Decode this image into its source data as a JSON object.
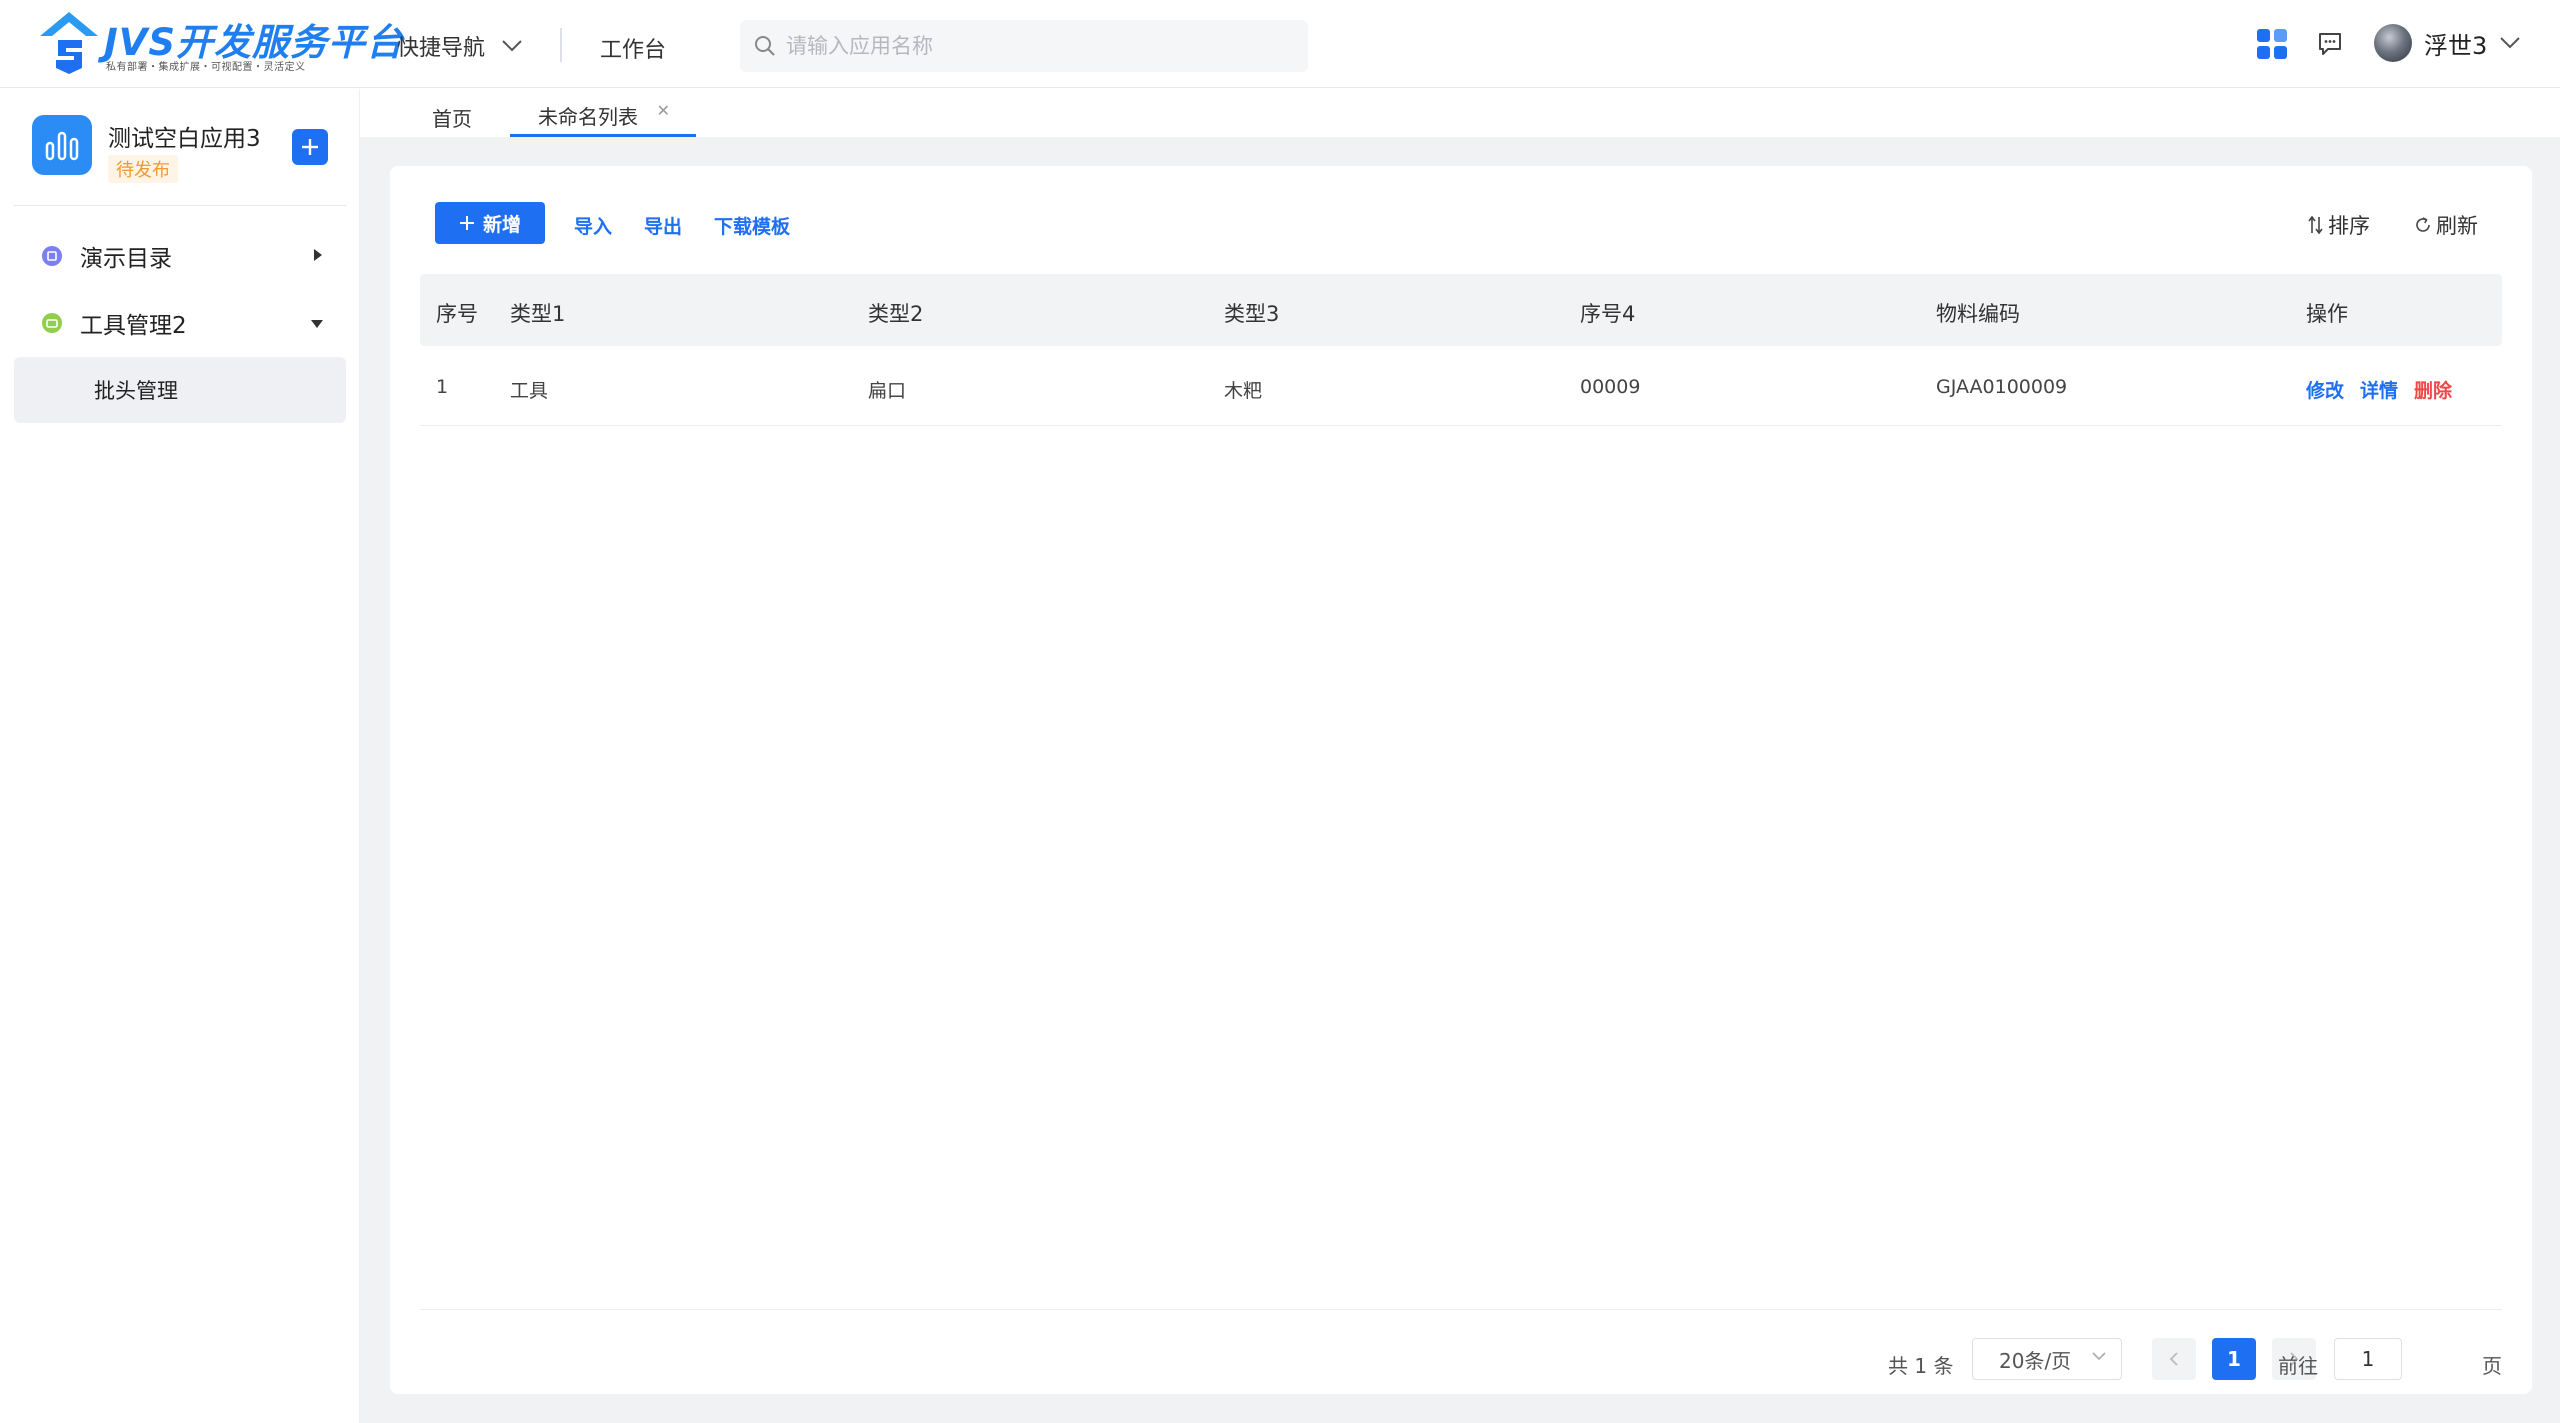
{
  "header": {
    "logo_title": "JVS开发服务平台",
    "logo_subtitle": "私有部署・集成扩展・可视配置・灵活定义",
    "quick_nav_label": "快捷导航",
    "workbench_label": "工作台",
    "search_placeholder": "请输入应用名称",
    "username": "浮世3",
    "icons": [
      "apps-grid-icon",
      "message-icon",
      "chevron-down-icon"
    ]
  },
  "sidebar": {
    "app_name": "测试空白应用3",
    "app_status": "待发布",
    "menu": [
      {
        "label": "演示目录",
        "icon": "catalog-icon",
        "color": "#7b7ff2",
        "expanded": false
      },
      {
        "label": "工具管理2",
        "icon": "tool-icon",
        "color": "#8fcf4a",
        "expanded": true
      }
    ],
    "submenu": [
      {
        "label": "批头管理",
        "active": true
      }
    ]
  },
  "tabs": [
    {
      "label": "首页",
      "active": false
    },
    {
      "label": "未命名列表",
      "active": true,
      "closable": true
    }
  ],
  "toolbar": {
    "new_label": "新增",
    "import_label": "导入",
    "export_label": "导出",
    "template_label": "下载模板",
    "sort_label": "排序",
    "refresh_label": "刷新"
  },
  "table": {
    "columns": [
      "序号",
      "类型1",
      "类型2",
      "类型3",
      "序号4",
      "物料编码",
      "操作"
    ],
    "rows": [
      {
        "index": "1",
        "type1": "工具",
        "type2": "扁口",
        "type3": "木粑",
        "seq4": "00009",
        "code": "GJAA0100009",
        "actions": {
          "edit": "修改",
          "detail": "详情",
          "delete": "删除"
        }
      }
    ]
  },
  "pagination": {
    "total_text": "共 1 条",
    "page_size": "20条/页",
    "current_page": "1",
    "goto_prefix": "前往",
    "goto_value": "1",
    "goto_suffix": "页"
  },
  "colors": {
    "primary": "#1f6ff2",
    "danger": "#f04848",
    "status_orange": "#f29a2e"
  }
}
